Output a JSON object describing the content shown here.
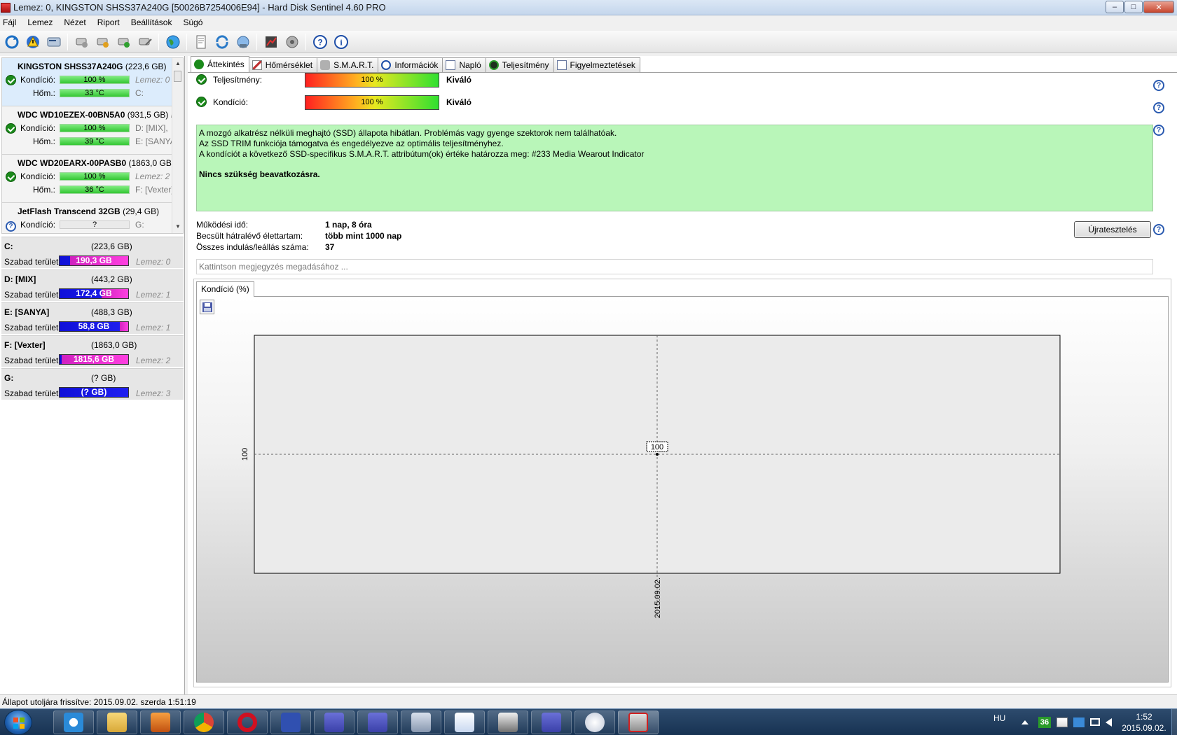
{
  "window": {
    "title": "Lemez: 0, KINGSTON SHSS37A240G [50026B7254006E94]  -  Hard Disk Sentinel 4.60 PRO"
  },
  "menu": [
    "Fájl",
    "Lemez",
    "Nézet",
    "Riport",
    "Beállítások",
    "Súgó"
  ],
  "disks": [
    {
      "name": "KINGSTON SHSS37A240G",
      "size": "(223,6 GB)",
      "health_label": "Kondíció:",
      "health": "100 %",
      "health_pct": 100,
      "temp_label": "Hőm.:",
      "temp": "33 °C",
      "right1": "Lemez: 0",
      "right2": "C:",
      "status": "ok",
      "selected": true
    },
    {
      "name": "WDC WD10EZEX-00BN5A0",
      "size": "(931,5 GB)",
      "health_label": "Kondíció:",
      "health": "100 %",
      "health_pct": 100,
      "temp_label": "Hőm.:",
      "temp": "39 °C",
      "right1": "D: [MIX],",
      "right2": "E: [SANYA",
      "status": "ok",
      "extra": "Le"
    },
    {
      "name": "WDC WD20EARX-00PASB0",
      "size": "(1863,0 GB)",
      "health_label": "Kondíció:",
      "health": "100 %",
      "health_pct": 100,
      "temp_label": "Hőm.:",
      "temp": "36 °C",
      "right1": "Lemez: 2",
      "right2": "F: [Vexter]",
      "status": "ok"
    },
    {
      "name": "JetFlash Transcend 32GB",
      "size": "(29,4 GB)",
      "health_label": "Kondíció:",
      "health": "?",
      "right1": "G:",
      "status": "unknown"
    }
  ],
  "volumes": [
    {
      "name": "C:",
      "size": "(223,6 GB)",
      "free_label": "Szabad terület",
      "free": "190,3 GB",
      "free_pct": 85,
      "disk": "Lemez: 0"
    },
    {
      "name": "D: [MIX]",
      "size": "(443,2 GB)",
      "free_label": "Szabad terület",
      "free": "172,4 GB",
      "free_pct": 39,
      "disk": "Lemez: 1"
    },
    {
      "name": "E: [SANYA]",
      "size": "(488,3 GB)",
      "free_label": "Szabad terület",
      "free": "58,8 GB",
      "free_pct": 12,
      "disk": "Lemez: 1"
    },
    {
      "name": "F: [Vexter]",
      "size": "(1863,0 GB)",
      "free_label": "Szabad terület",
      "free": "1815,6 GB",
      "free_pct": 97,
      "disk": "Lemez: 2"
    },
    {
      "name": "G:",
      "size": "(? GB)",
      "free_label": "Szabad terület",
      "free": "(? GB)",
      "free_pct": 0,
      "disk": "Lemez: 3"
    }
  ],
  "tabs": [
    "Áttekintés",
    "Hőmérséklet",
    "S.M.A.R.T.",
    "Információk",
    "Napló",
    "Teljesítmény",
    "Figyelmeztetések"
  ],
  "overview": {
    "performance_label": "Teljesítmény:",
    "performance_value": "100 %",
    "performance_pct": 100,
    "performance_verdict": "Kiváló",
    "health_label": "Kondíció:",
    "health_value": "100 %",
    "health_pct": 100,
    "health_verdict": "Kiváló",
    "info_lines": [
      "A mozgó alkatrész nélküli meghajtó (SSD) állapota hibátlan. Problémás vagy gyenge szektorok nem találhatóak.",
      "Az SSD TRIM funkciója támogatva és engedélyezve az optimális teljesítményhez.",
      "A kondíciót a következő SSD-specifikus S.M.A.R.T. attribútum(ok) értéke határozza meg:  #233 Media Wearout Indicator"
    ],
    "info_bold": "Nincs szükség beavatkozásra.",
    "uptime_label": "Működési idő:",
    "uptime_value": "1 nap, 8 óra",
    "remaining_label": "Becsült hátralévő élettartam:",
    "remaining_value": "több mint 1000 nap",
    "starts_label": "Összes indulás/leállás száma:",
    "starts_value": "37",
    "retest_label": "Újratesztelés",
    "note_placeholder": "Kattintson megjegyzés megadásához ..."
  },
  "chart_tab": "Kondíció  (%)",
  "chart_data": {
    "type": "line",
    "x": [
      "2015.09.02."
    ],
    "series": [
      {
        "values": [
          100
        ]
      }
    ],
    "ytick_labels": [
      "100"
    ],
    "xtick_labels": [
      "2015.09.02."
    ],
    "data_labels": [
      "100"
    ],
    "grid": true
  },
  "statusbar": "Állapot utoljára frissítve: 2015.09.02. szerda 1:51:19",
  "taskbar": {
    "lang": "HU",
    "tray_badge": "36",
    "time": "1:52",
    "date": "2015.09.02."
  }
}
